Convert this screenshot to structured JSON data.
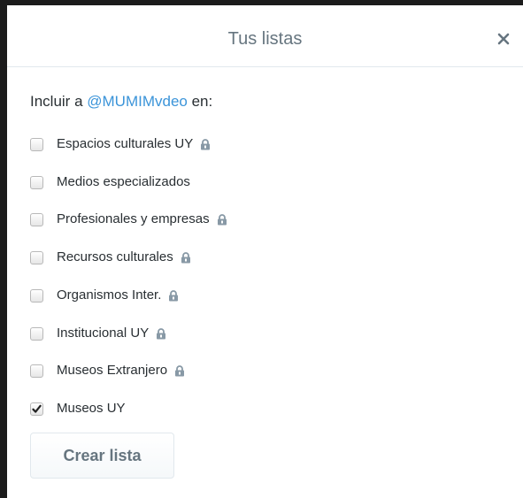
{
  "dialog": {
    "title": "Tus listas",
    "close_icon": "close-icon"
  },
  "include": {
    "prefix": "Incluir a ",
    "user": "@MUMIMvdeo",
    "suffix": " en:"
  },
  "lists": [
    {
      "label": "Espacios culturales UY",
      "checked": false,
      "locked": true
    },
    {
      "label": "Medios especializados",
      "checked": false,
      "locked": false
    },
    {
      "label": "Profesionales y empresas",
      "checked": false,
      "locked": true
    },
    {
      "label": "Recursos culturales",
      "checked": false,
      "locked": true
    },
    {
      "label": "Organismos Inter.",
      "checked": false,
      "locked": true
    },
    {
      "label": "Institucional UY",
      "checked": false,
      "locked": true
    },
    {
      "label": "Museos Extranjero",
      "checked": false,
      "locked": true
    },
    {
      "label": "Museos UY",
      "checked": true,
      "locked": false
    }
  ],
  "actions": {
    "create_label": "Crear lista"
  },
  "colors": {
    "title": "#66757f",
    "user_link": "#3b94d9",
    "text": "#292f33",
    "lock": "#8899a6"
  }
}
